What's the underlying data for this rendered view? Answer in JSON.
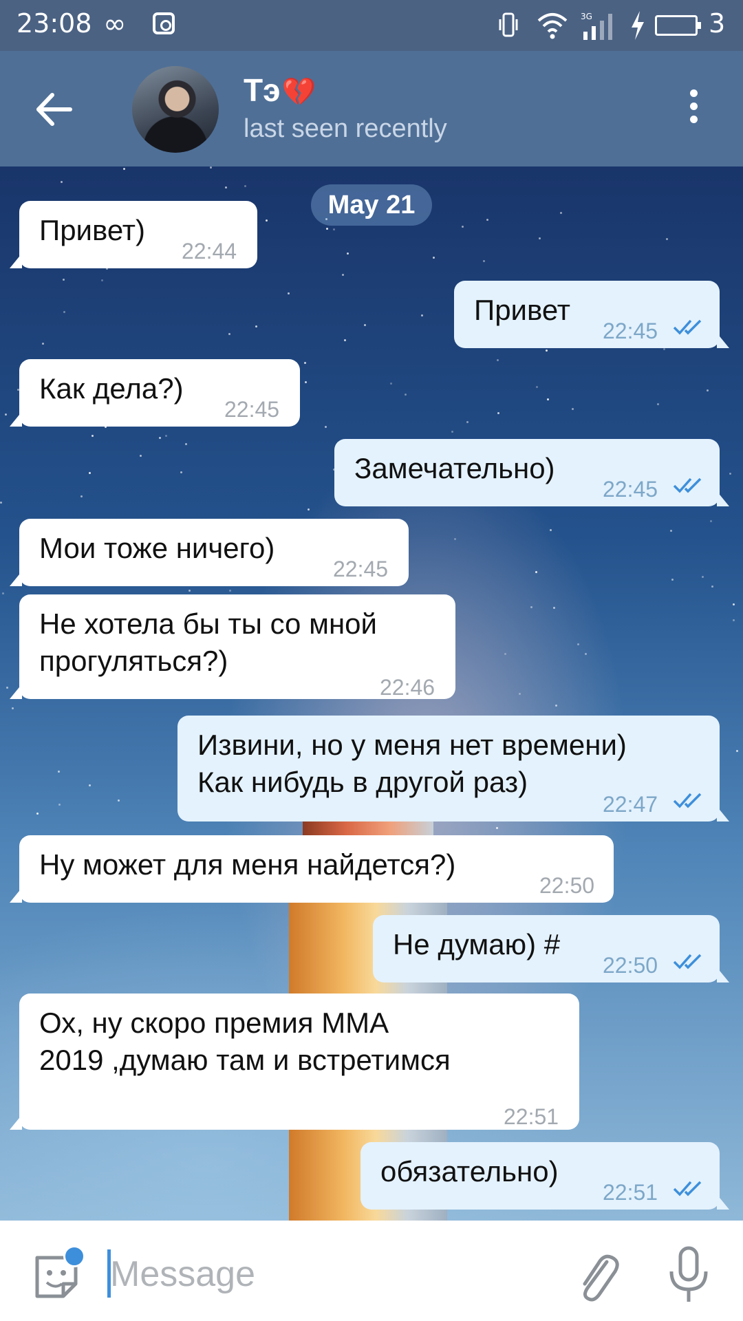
{
  "status_bar": {
    "time": "23:08",
    "loop_glyph": "∞",
    "battery_level": "3",
    "icons": [
      "infinity-icon",
      "instagram-icon",
      "vibrate-icon",
      "wifi-icon",
      "signal-3g-icon",
      "charging-icon",
      "battery-icon"
    ]
  },
  "header": {
    "contact_name": "Тэ",
    "contact_emoji": "💔",
    "last_seen": "last seen recently"
  },
  "chat": {
    "date": "May 21",
    "messages": [
      {
        "dir": "in",
        "text": "Привет)",
        "time": "22:44"
      },
      {
        "dir": "out",
        "text": "Привет",
        "time": "22:45",
        "read": true
      },
      {
        "dir": "in",
        "text": "Как дела?)",
        "time": "22:45"
      },
      {
        "dir": "out",
        "text": "Замечательно)",
        "time": "22:45",
        "read": true
      },
      {
        "dir": "in",
        "text": "Мои тоже ничего)",
        "time": "22:45"
      },
      {
        "dir": "in",
        "text": "Не хотела бы ты со мной\nпрогуляться?)",
        "time": "22:46"
      },
      {
        "dir": "out",
        "text": "Извини, но у меня нет времени)\nКак нибудь в другой раз)",
        "time": "22:47",
        "read": true
      },
      {
        "dir": "in",
        "text": "Ну может для меня найдется?)",
        "time": "22:50"
      },
      {
        "dir": "out",
        "text": "Не думаю) #",
        "time": "22:50",
        "read": true
      },
      {
        "dir": "in",
        "text": "Ох, ну скоро премия MMA\n2019 ,думаю там и встретимся",
        "time": "22:51"
      },
      {
        "dir": "out",
        "text": "обязательно)",
        "time": "22:51",
        "read": true
      }
    ]
  },
  "input": {
    "placeholder": "Message"
  },
  "colors": {
    "header_bg": "#4f6f96",
    "status_bar_bg": "#4b6283",
    "incoming_bubble": "#ffffff",
    "outgoing_bubble": "#e4f2fd",
    "accent": "#3d8fdb"
  }
}
